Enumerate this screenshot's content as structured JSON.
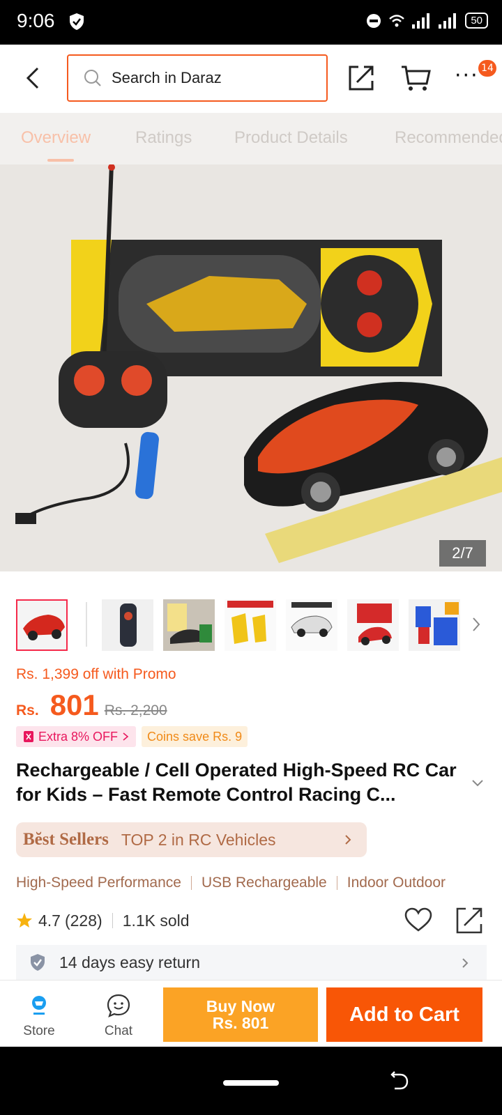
{
  "status_bar": {
    "time": "9:06",
    "battery": "50"
  },
  "header": {
    "search_placeholder": "Search in Daraz",
    "cart_badge": "14"
  },
  "tabs": [
    "Overview",
    "Ratings",
    "Product Details",
    "Recommended"
  ],
  "gallery": {
    "counter": "2/7",
    "thumbnail_count": 7
  },
  "pricing": {
    "promo": "Rs. 1,399 off with Promo",
    "currency": "Rs.",
    "price": "801",
    "original_price": "Rs. 2,200",
    "extra_off": "Extra 8% OFF",
    "coins": "Coins save Rs. 9"
  },
  "product": {
    "title": "Rechargeable / Cell Operated High-Speed RC Car for Kids – Fast Remote Control Racing C...",
    "bestseller_badge": "Bĕst Sellers",
    "bestseller_text": "TOP 2 in RC Vehicles",
    "features": [
      "High-Speed Performance",
      "USB Rechargeable",
      "Indoor Outdoor"
    ],
    "rating": "4.7",
    "review_count": "(228)",
    "sold": "1.1K sold",
    "return_policy": "14 days easy return"
  },
  "actions": {
    "store_label": "Store",
    "chat_label": "Chat",
    "buy_now_line1": "Buy Now",
    "buy_now_line2": "Rs. 801",
    "add_to_cart": "Add to Cart"
  },
  "colors": {
    "accent": "#f85606",
    "buy_now": "#fba325",
    "promo_pink": "#e8175d",
    "bestseller": "#b06a45"
  }
}
